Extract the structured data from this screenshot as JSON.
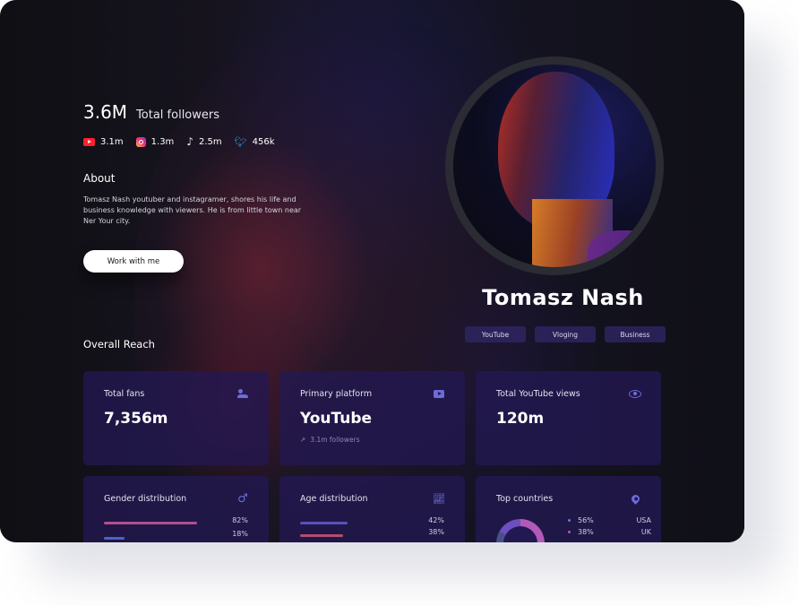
{
  "profile": {
    "total_followers_value": "3.6M",
    "total_followers_label": "Total followers",
    "socials": [
      {
        "icon": "youtube-icon",
        "count": "3.1m"
      },
      {
        "icon": "instagram-icon",
        "count": "1.3m"
      },
      {
        "icon": "tiktok-icon",
        "count": "2.5m"
      },
      {
        "icon": "twitter-icon",
        "count": "456k"
      }
    ],
    "about_title": "About",
    "about_text": "Tomasz Nash youtuber and instagramer, shores his life and business knowledge with viewers. He is from little town near Ner Your city.",
    "cta_label": "Work with me",
    "name": "Tomasz Nash",
    "tags": [
      "YouTube",
      "Vloging",
      "Business"
    ]
  },
  "reach": {
    "title": "Overall Reach",
    "cards": [
      {
        "label": "Total fans",
        "value": "7,356m",
        "icon": "people-icon"
      },
      {
        "label": "Primary platform",
        "value": "YouTube",
        "sub": "3.1m followers",
        "icon": "youtube-play-icon"
      },
      {
        "label": "Total YouTube views",
        "value": "120m",
        "icon": "eye-icon"
      }
    ],
    "gender": {
      "label": "Gender distribution",
      "icon": "male-icon",
      "rows": [
        {
          "pct": "82%",
          "value": 0.82,
          "color": "#b14f8f"
        },
        {
          "pct": "18%",
          "value": 0.18,
          "color": "#4b63c8"
        }
      ]
    },
    "age": {
      "label": "Age distribution",
      "icon": "chart-icon",
      "rows": [
        {
          "pct": "42%",
          "value": 0.42,
          "color": "#5a52b8"
        },
        {
          "pct": "38%",
          "value": 0.38,
          "color": "#b14f6f"
        }
      ]
    },
    "countries": {
      "label": "Top countries",
      "icon": "location-pin-icon",
      "rows": [
        {
          "pct": "56%",
          "name": "USA",
          "color": "#5b7dd9"
        },
        {
          "pct": "38%",
          "name": "UK",
          "color": "#b25ab8"
        }
      ]
    }
  }
}
